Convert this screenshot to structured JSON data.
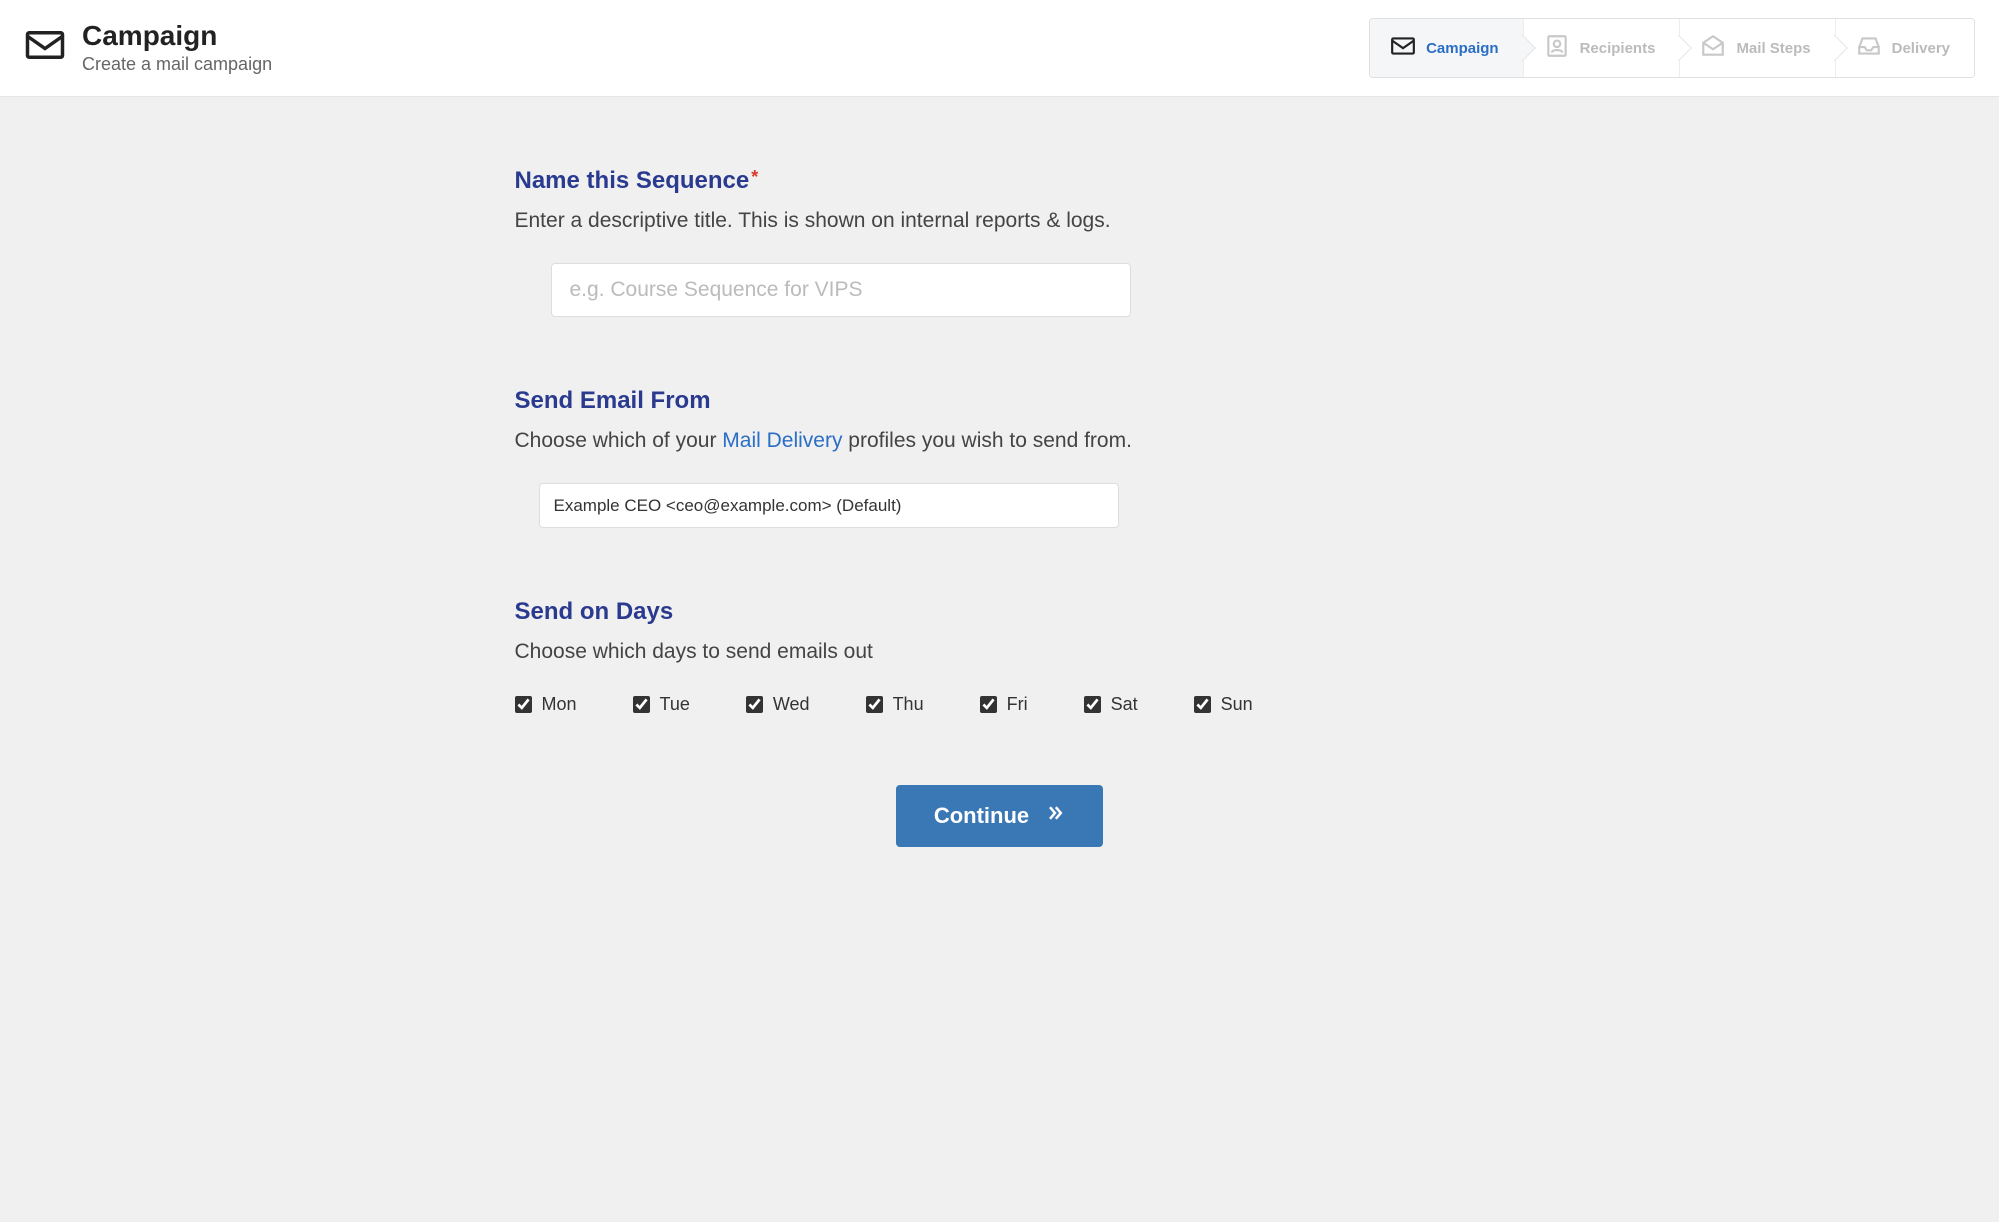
{
  "header": {
    "title": "Campaign",
    "subtitle": "Create a mail campaign"
  },
  "stepper": {
    "steps": [
      {
        "label": "Campaign",
        "active": true
      },
      {
        "label": "Recipients",
        "active": false
      },
      {
        "label": "Mail Steps",
        "active": false
      },
      {
        "label": "Delivery",
        "active": false
      }
    ]
  },
  "sections": {
    "name": {
      "title": "Name this Sequence",
      "required": true,
      "description": "Enter a descriptive title. This is shown on internal reports & logs.",
      "placeholder": "e.g. Course Sequence for VIPS",
      "value": ""
    },
    "from": {
      "title": "Send Email From",
      "desc_prefix": "Choose which of your ",
      "desc_link": "Mail Delivery",
      "desc_suffix": " profiles you wish to send from.",
      "selected": "Example CEO <ceo@example.com> (Default)"
    },
    "days": {
      "title": "Send on Days",
      "description": "Choose which days to send emails out",
      "items": [
        {
          "label": "Mon",
          "checked": true
        },
        {
          "label": "Tue",
          "checked": true
        },
        {
          "label": "Wed",
          "checked": true
        },
        {
          "label": "Thu",
          "checked": true
        },
        {
          "label": "Fri",
          "checked": true
        },
        {
          "label": "Sat",
          "checked": true
        },
        {
          "label": "Sun",
          "checked": true
        }
      ]
    }
  },
  "actions": {
    "continue_label": "Continue"
  }
}
